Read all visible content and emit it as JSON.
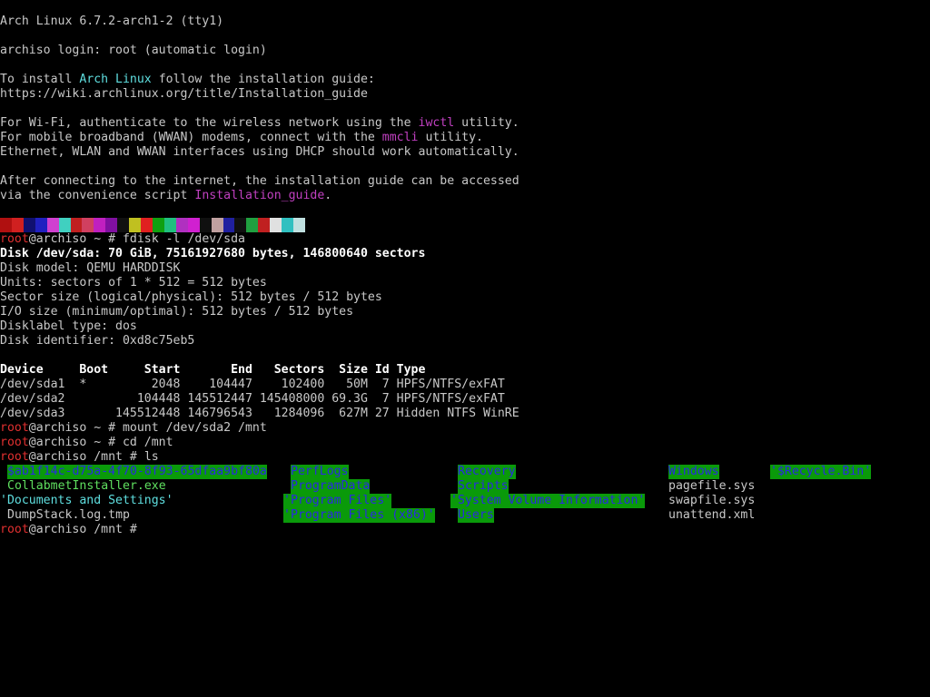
{
  "palette": {
    "background": "#000000",
    "text": "#c8c8c8",
    "prompt_user": "#e03030",
    "link_cyan": "#5fdfe0",
    "link_magenta": "#c040c0",
    "exec_green": "#5fdf5f",
    "dir_bg": "#0a9a0a",
    "dir_fg": "#2a2ae0"
  },
  "header": {
    "kernel": "Arch Linux 6.7.2-arch1-2 (tty1)",
    "login": "archiso login: root (automatic login)"
  },
  "intro": {
    "install_pre": "To install ",
    "install_name": "Arch Linux",
    "install_post": " follow the installation guide:",
    "guide_url": "https://wiki.archlinux.org/title/Installation_guide",
    "wifi_pre": "For Wi-Fi, authenticate to the wireless network using the ",
    "wifi_tool": "iwctl",
    "wifi_post": " utility.",
    "wwan_pre": "For mobile broadband (WWAN) modems, connect with the ",
    "wwan_tool": "mmcli",
    "wwan_post": " utility.",
    "dhcp": "Ethernet, WLAN and WWAN interfaces using DHCP should work automatically.",
    "after1": "After connecting to the internet, the installation guide can be accessed",
    "after2_pre": "via the convenience script ",
    "after2_script": "Installation_guide",
    "after2_post": "."
  },
  "colorbar": [
    "#b01010",
    "#d02020",
    "#101070",
    "#2020c0",
    "#d040d0",
    "#40d0c0",
    "#c02020",
    "#d04060",
    "#c020c0",
    "#8010a0",
    "#101010",
    "#c0c020",
    "#e02020",
    "#10a010",
    "#20c080",
    "#b030c0",
    "#d020d0",
    "#101010",
    "#c0a0a0",
    "#2020a0",
    "#101010",
    "#20a040",
    "#c02020",
    "#e0e0e0",
    "#30c0c0",
    "#c0e0e0"
  ],
  "session": {
    "prompt_user": "root",
    "prompt_host_home": "@archiso ~ # ",
    "prompt_host_mnt": "@archiso /mnt # ",
    "cmd_fdisk": "fdisk -l /dev/sda",
    "cmd_mount": "mount /dev/sda2 /mnt",
    "cmd_cd": "cd /mnt",
    "cmd_ls": "ls"
  },
  "fdisk": {
    "disk_line": "Disk /dev/sda: 70 GiB, 75161927680 bytes, 146800640 sectors",
    "model": "Disk model: QEMU HARDDISK",
    "units": "Units: sectors of 1 * 512 = 512 bytes",
    "sector_size": "Sector size (logical/physical): 512 bytes / 512 bytes",
    "io_size": "I/O size (minimum/optimal): 512 bytes / 512 bytes",
    "label_type": "Disklabel type: dos",
    "identifier": "Disk identifier: 0xd8c75eb5",
    "table_header": "Device     Boot     Start       End   Sectors  Size Id Type",
    "rows": [
      "/dev/sda1  *         2048    104447    102400   50M  7 HPFS/NTFS/exFAT",
      "/dev/sda2          104448 145512447 145408000 69.3G  7 HPFS/NTFS/exFAT",
      "/dev/sda3       145512448 146796543   1284096  627M 27 Hidden NTFS WinRE"
    ]
  },
  "ls": {
    "col1": [
      "$ab1f14c-d75a-4f70-8f93-65dfaa9bf80a",
      "CollabmetInstaller.exe",
      "'Documents and Settings'",
      "DumpStack.log.tmp"
    ],
    "col2": [
      "PerfLogs",
      "ProgramData",
      "'Program Files'",
      "'Program Files (x86)'"
    ],
    "col3": [
      "Recovery",
      "Scripts",
      "'System Volume Information'",
      "Users"
    ],
    "col4": [
      "Windows",
      "pagefile.sys",
      "swapfile.sys",
      "unattend.xml"
    ],
    "col5": [
      "'$Recycle.Bin'"
    ]
  }
}
